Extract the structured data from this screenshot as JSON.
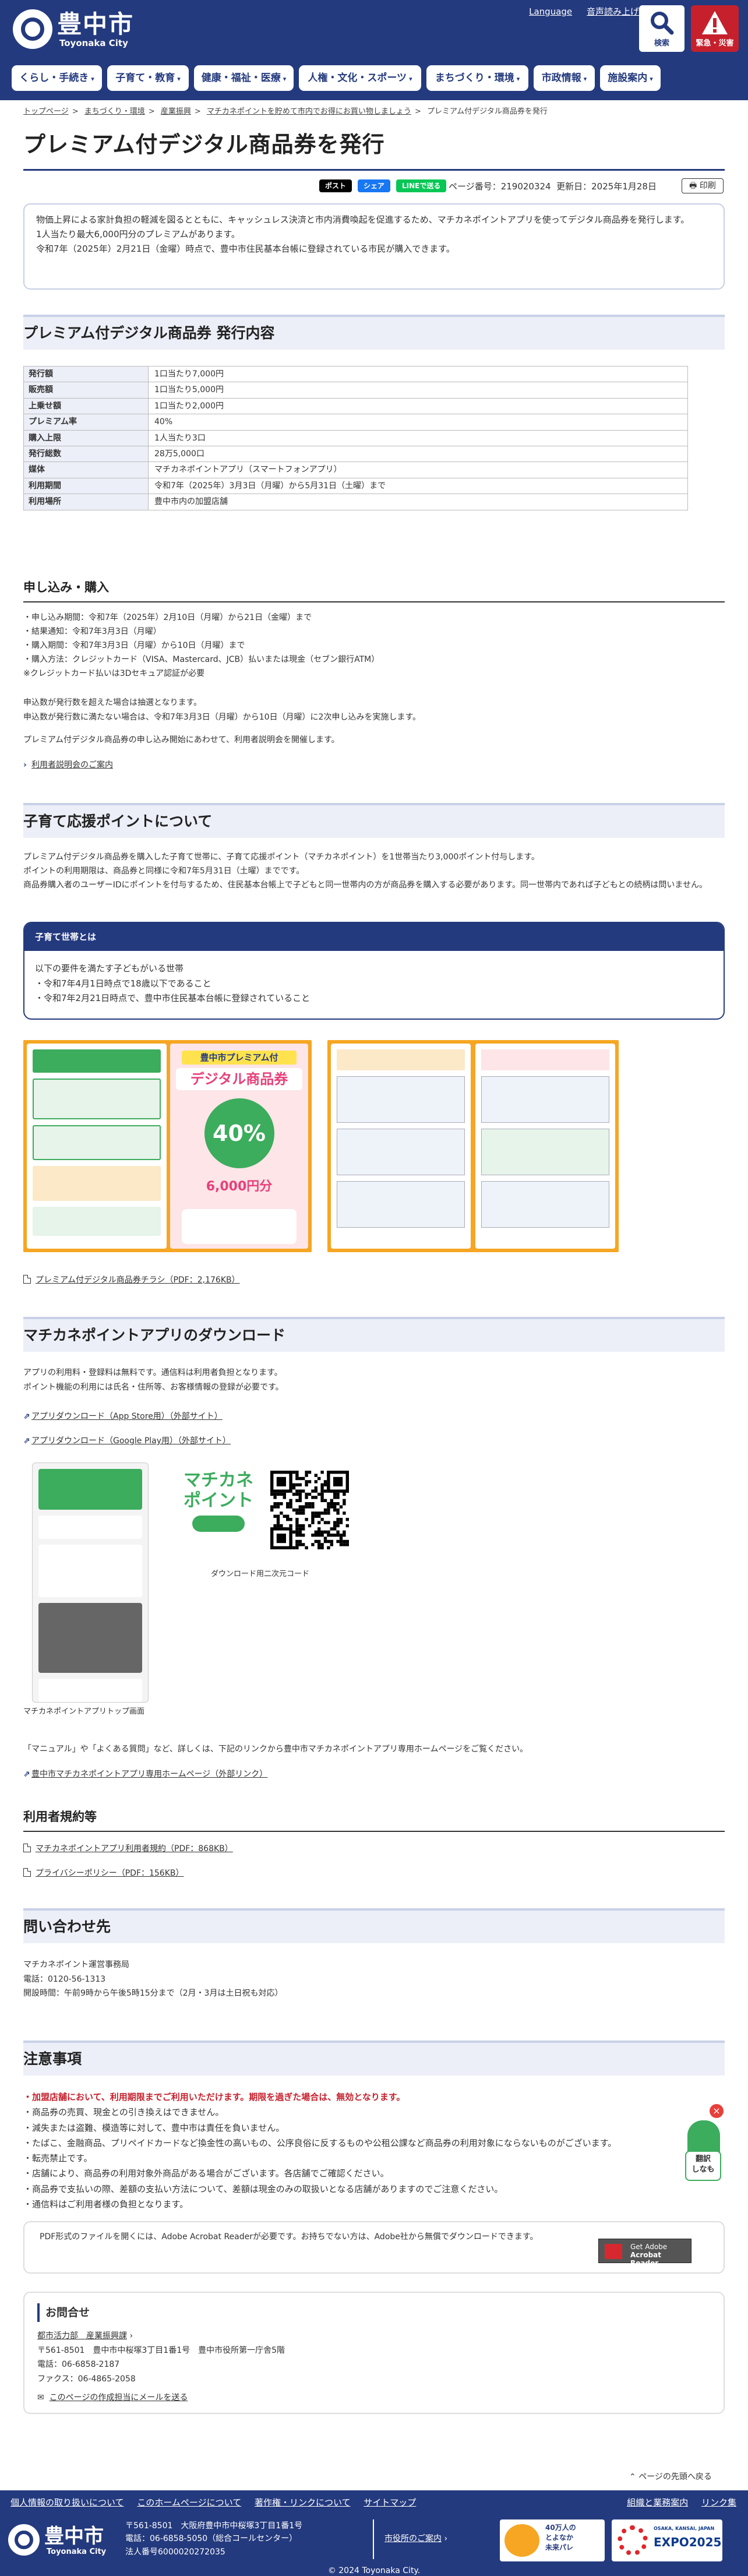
{
  "header": {
    "logo_jp": "豊中市",
    "logo_en": "Toyonaka City",
    "language_link": "Language",
    "accessibility_link": "音声読み上げ/文字拡大",
    "search_label": "検索",
    "emergency_label": "緊急・災害"
  },
  "nav": [
    "くらし・手続き",
    "子育て・教育",
    "健康・福祉・医療",
    "人権・文化・スポーツ",
    "まちづくり・環境",
    "市政情報",
    "施設案内"
  ],
  "breadcrumb": {
    "items": [
      "トップページ",
      "まちづくり・環境",
      "産業振興",
      "マチカネポイントを貯めて市内でお得にお買い物しましょう"
    ],
    "current": "プレミアム付デジタル商品券を発行",
    "separator": ">"
  },
  "page": {
    "title": "プレミアム付デジタル商品券を発行",
    "page_number": "ページ番号：219020324",
    "updated": "更新日：2025年1月28日",
    "print_label": "印刷",
    "social": {
      "x": "ポスト",
      "facebook": "シェア",
      "line": "LINEで送る"
    }
  },
  "intro": [
    "物価上昇による家計負担の軽減を図るとともに、キャッシュレス決済と市内消費喚起を促進するため、マチカネポイントアプリを使ってデジタル商品券を発行します。",
    "1人当たり最大6,000円分のプレミアムがあります。",
    "令和7年（2025年）2月21日（金曜）時点で、豊中市住民基本台帳に登録されている市民が購入できます。"
  ],
  "spec_section": {
    "heading": "プレミアム付デジタル商品券 発行内容",
    "rows": [
      {
        "label": "発行額",
        "value": "1口当たり7,000円"
      },
      {
        "label": "販売額",
        "value": "1口当たり5,000円"
      },
      {
        "label": "上乗せ額",
        "value": "1口当たり2,000円"
      },
      {
        "label": "プレミアム率",
        "value": "40%"
      },
      {
        "label": "購入上限",
        "value": "1人当たり3口"
      },
      {
        "label": "発行総数",
        "value": "28万5,000口"
      },
      {
        "label": "媒体",
        "value": "マチカネポイントアプリ（スマートフォンアプリ）"
      },
      {
        "label": "利用期間",
        "value": "令和7年（2025年）3月3日（月曜）から5月31日（土曜）まで"
      },
      {
        "label": "利用場所",
        "value": "豊中市内の加盟店舗"
      }
    ]
  },
  "apply_section": {
    "heading": "申し込み・購入",
    "bullets": [
      "・申し込み期間：令和7年（2025年）2月10日（月曜）から21日（金曜）まで",
      "・結果通知：令和7年3月3日（月曜）",
      "・購入期間：令和7年3月3日（月曜）から10日（月曜）まで",
      "・購入方法：クレジットカード（VISA、Mastercard、JCB）払いまたは現金（セブン銀行ATM）",
      "※クレジットカード払いは3Dセキュア認証が必要"
    ],
    "note1": "申込数が発行数を超えた場合は抽選となります。",
    "note2": "申込数が発行数に満たない場合は、令和7年3月3日（月曜）から10日（月曜）に2次申し込みを実施します。",
    "note3": "プレミアム付デジタル商品券の申し込み開始にあわせて、利用者説明会を開催します。",
    "link": "利用者説明会のご案内"
  },
  "child_section": {
    "heading": "子育て応援ポイントについて",
    "para1": "プレミアム付デジタル商品券を購入した子育て世帯に、子育て応援ポイント（マチカネポイント）を1世帯当たり3,000ポイント付与します。",
    "para2": "ポイントの利用期限は、商品券と同様に令和7年5月31日（土曜）までです。",
    "para3": "商品券購入者のユーザーIDにポイントを付与するため、住民基本台帳上で子どもと同一世帯内の方が商品券を購入する必要があります。同一世帯内であれば子どもとの続柄は問いません。",
    "box_heading": "子育て世帯とは",
    "box_lines": [
      "以下の要件を満たす子どもがいる世帯",
      "・令和7年4月1日時点で18歳以下であること",
      "・令和7年2月21日時点で、豊中市住民基本台帳に登録されていること"
    ]
  },
  "flyer": {
    "badge_top": "豊中市プレミアム付",
    "badge_main": "デジタル商品券",
    "percent": "40%",
    "premium_text": "6,000円分",
    "link": "プレミアム付デジタル商品券チラシ（PDF：2,176KB）"
  },
  "app_section": {
    "heading": "マチカネポイントアプリのダウンロード",
    "para1": "アプリの利用料・登録料は無料です。通信料は利用者負担となります。",
    "para2": "ポイント機能の利用には氏名・住所等、お客様情報の登録が必要です。",
    "link_ios": "アプリダウンロード（App Store用）（外部サイト）",
    "link_android": "アプリダウンロード（Google Play用）（外部サイト）",
    "app_top_caption": "マチカネポイントアプリトップ画面",
    "qr_caption": "ダウンロード用二次元コード",
    "logo_text_1": "マチカネ",
    "logo_text_2": "ポイント",
    "more_text": "「マニュアル」や「よくある質問」など、詳しくは、下記のリンクから豊中市マチカネポイントアプリ専用ホームページをご覧ください。",
    "more_link": "豊中市マチカネポイントアプリ専用ホームページ（外部リンク）"
  },
  "terms_section": {
    "heading": "利用者規約等",
    "link1": "マチカネポイントアプリ利用者規約（PDF：868KB）",
    "link2": "プライバシーポリシー（PDF：156KB）"
  },
  "inquiry_section": {
    "heading": "問い合わせ先",
    "lines": [
      "マチカネポイント運営事務局",
      "電話：0120-56-1313",
      "開設時間：午前9時から午後5時15分まで（2月・3月は土日祝も対応）"
    ]
  },
  "caution_section": {
    "heading": "注意事項",
    "red_line": "・加盟店舗において、利用期限までご利用いただけます。期限を過ぎた場合は、無効となります。",
    "lines": [
      "・商品券の売買、現金との引き換えはできません。",
      "・減失または盗難、模造等に対して、豊中市は責任を負いません。",
      "・たばこ、金融商品、プリペイドカードなど換金性の高いもの、公序良俗に反するものや公租公課など商品券の利用対象にならないものがございます。",
      "・転売禁止です。",
      "・店舗により、商品券の利用対象外商品がある場合がございます。各店舗でご確認ください。",
      "・商品券で支払いの際、差額の支払い方法について、差額は現金のみの取扱いとなる店舗がありますのでご注意ください。",
      "・通信料はご利用者様の負担となります。"
    ],
    "frog_label_1": "翻訳",
    "frog_label_2": "しなも"
  },
  "pdf_notice": {
    "text": "PDF形式のファイルを開くには、Adobe Acrobat Readerが必要です。お持ちでない方は、Adobe社から無償でダウンロードできます。",
    "badge_1": "Get Adobe",
    "badge_2": "Acrobat Reader"
  },
  "contact": {
    "heading": "お問合せ",
    "dept": "都市活力部　産業振興課",
    "address": "〒561-8501　豊中市中桜塚3丁目1番1号　豊中市役所第一庁舎5階",
    "tel": "電話：06-6858-2187",
    "fax": "ファクス：06-4865-2058",
    "mail_link": "このページの作成担当にメールを送る"
  },
  "back_to_top": "ページの先頭へ戻る",
  "footer": {
    "links": [
      "個人情報の取り扱いについて",
      "このホームページについて",
      "著作権・リンクについて",
      "サイトマップ"
    ],
    "right_links": [
      "組織と業務案内",
      "リンク集"
    ],
    "logo_jp": "豊中市",
    "logo_en": "Toyonaka City",
    "address": "〒561-8501　大阪府豊中市中桜塚3丁目1番1号",
    "tel": "電話：06-6858-5050（総合コールセンター）",
    "corp": "法人番号6000020272035",
    "access_link": "市役所のご案内",
    "badge1_line1": "40万人の",
    "badge1_line2": "とよなか",
    "badge1_line3": "未来パレ",
    "badge2_line1": "OSAKA, KANSAI, JAPAN",
    "badge2_line2": "EXPO2025",
    "copyright": "© 2024 Toyonaka City."
  },
  "colors": {
    "brand": "#243a7e",
    "emergency": "#c6202c",
    "section_bg": "#eceff7",
    "warning": "#c6202c"
  }
}
